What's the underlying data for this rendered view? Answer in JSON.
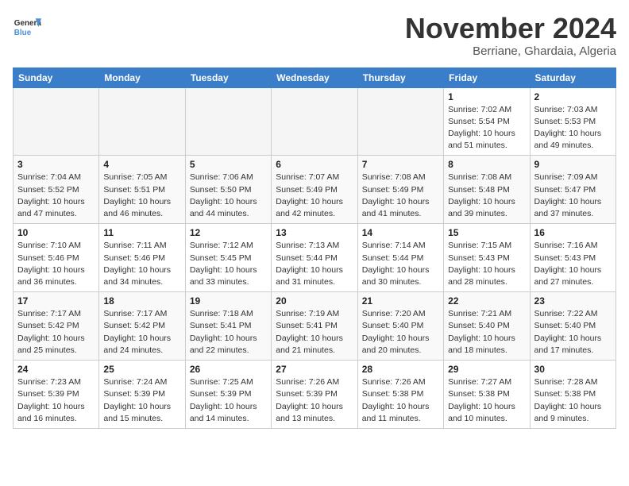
{
  "header": {
    "logo_line1": "General",
    "logo_line2": "Blue",
    "month_title": "November 2024",
    "location": "Berriane, Ghardaia, Algeria"
  },
  "weekdays": [
    "Sunday",
    "Monday",
    "Tuesday",
    "Wednesday",
    "Thursday",
    "Friday",
    "Saturday"
  ],
  "weeks": [
    [
      {
        "day": "",
        "empty": true
      },
      {
        "day": "",
        "empty": true
      },
      {
        "day": "",
        "empty": true
      },
      {
        "day": "",
        "empty": true
      },
      {
        "day": "",
        "empty": true
      },
      {
        "day": "1",
        "sunrise": "7:02 AM",
        "sunset": "5:54 PM",
        "daylight": "10 hours and 51 minutes."
      },
      {
        "day": "2",
        "sunrise": "7:03 AM",
        "sunset": "5:53 PM",
        "daylight": "10 hours and 49 minutes."
      }
    ],
    [
      {
        "day": "3",
        "sunrise": "7:04 AM",
        "sunset": "5:52 PM",
        "daylight": "10 hours and 47 minutes."
      },
      {
        "day": "4",
        "sunrise": "7:05 AM",
        "sunset": "5:51 PM",
        "daylight": "10 hours and 46 minutes."
      },
      {
        "day": "5",
        "sunrise": "7:06 AM",
        "sunset": "5:50 PM",
        "daylight": "10 hours and 44 minutes."
      },
      {
        "day": "6",
        "sunrise": "7:07 AM",
        "sunset": "5:49 PM",
        "daylight": "10 hours and 42 minutes."
      },
      {
        "day": "7",
        "sunrise": "7:08 AM",
        "sunset": "5:49 PM",
        "daylight": "10 hours and 41 minutes."
      },
      {
        "day": "8",
        "sunrise": "7:08 AM",
        "sunset": "5:48 PM",
        "daylight": "10 hours and 39 minutes."
      },
      {
        "day": "9",
        "sunrise": "7:09 AM",
        "sunset": "5:47 PM",
        "daylight": "10 hours and 37 minutes."
      }
    ],
    [
      {
        "day": "10",
        "sunrise": "7:10 AM",
        "sunset": "5:46 PM",
        "daylight": "10 hours and 36 minutes."
      },
      {
        "day": "11",
        "sunrise": "7:11 AM",
        "sunset": "5:46 PM",
        "daylight": "10 hours and 34 minutes."
      },
      {
        "day": "12",
        "sunrise": "7:12 AM",
        "sunset": "5:45 PM",
        "daylight": "10 hours and 33 minutes."
      },
      {
        "day": "13",
        "sunrise": "7:13 AM",
        "sunset": "5:44 PM",
        "daylight": "10 hours and 31 minutes."
      },
      {
        "day": "14",
        "sunrise": "7:14 AM",
        "sunset": "5:44 PM",
        "daylight": "10 hours and 30 minutes."
      },
      {
        "day": "15",
        "sunrise": "7:15 AM",
        "sunset": "5:43 PM",
        "daylight": "10 hours and 28 minutes."
      },
      {
        "day": "16",
        "sunrise": "7:16 AM",
        "sunset": "5:43 PM",
        "daylight": "10 hours and 27 minutes."
      }
    ],
    [
      {
        "day": "17",
        "sunrise": "7:17 AM",
        "sunset": "5:42 PM",
        "daylight": "10 hours and 25 minutes."
      },
      {
        "day": "18",
        "sunrise": "7:17 AM",
        "sunset": "5:42 PM",
        "daylight": "10 hours and 24 minutes."
      },
      {
        "day": "19",
        "sunrise": "7:18 AM",
        "sunset": "5:41 PM",
        "daylight": "10 hours and 22 minutes."
      },
      {
        "day": "20",
        "sunrise": "7:19 AM",
        "sunset": "5:41 PM",
        "daylight": "10 hours and 21 minutes."
      },
      {
        "day": "21",
        "sunrise": "7:20 AM",
        "sunset": "5:40 PM",
        "daylight": "10 hours and 20 minutes."
      },
      {
        "day": "22",
        "sunrise": "7:21 AM",
        "sunset": "5:40 PM",
        "daylight": "10 hours and 18 minutes."
      },
      {
        "day": "23",
        "sunrise": "7:22 AM",
        "sunset": "5:40 PM",
        "daylight": "10 hours and 17 minutes."
      }
    ],
    [
      {
        "day": "24",
        "sunrise": "7:23 AM",
        "sunset": "5:39 PM",
        "daylight": "10 hours and 16 minutes."
      },
      {
        "day": "25",
        "sunrise": "7:24 AM",
        "sunset": "5:39 PM",
        "daylight": "10 hours and 15 minutes."
      },
      {
        "day": "26",
        "sunrise": "7:25 AM",
        "sunset": "5:39 PM",
        "daylight": "10 hours and 14 minutes."
      },
      {
        "day": "27",
        "sunrise": "7:26 AM",
        "sunset": "5:39 PM",
        "daylight": "10 hours and 13 minutes."
      },
      {
        "day": "28",
        "sunrise": "7:26 AM",
        "sunset": "5:38 PM",
        "daylight": "10 hours and 11 minutes."
      },
      {
        "day": "29",
        "sunrise": "7:27 AM",
        "sunset": "5:38 PM",
        "daylight": "10 hours and 10 minutes."
      },
      {
        "day": "30",
        "sunrise": "7:28 AM",
        "sunset": "5:38 PM",
        "daylight": "10 hours and 9 minutes."
      }
    ]
  ]
}
